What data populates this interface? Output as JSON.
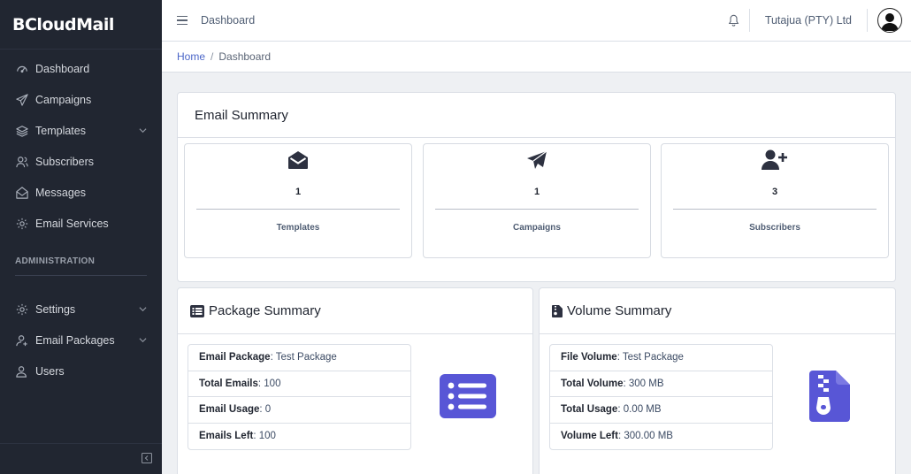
{
  "brand": {
    "name": "BCloudMail"
  },
  "sidebar": {
    "items": [
      {
        "label": "Dashboard",
        "icon": "speedometer-icon"
      },
      {
        "label": "Campaigns",
        "icon": "paper-plane-icon"
      },
      {
        "label": "Templates",
        "icon": "layers-icon"
      },
      {
        "label": "Subscribers",
        "icon": "people-icon"
      },
      {
        "label": "Messages",
        "icon": "envelope-open-icon"
      },
      {
        "label": "Email Services",
        "icon": "gear-icon"
      }
    ],
    "admin_title": "ADMINISTRATION",
    "admin_items": [
      {
        "label": "Settings",
        "icon": "gear-icon"
      },
      {
        "label": "Email Packages",
        "icon": "user-add-icon"
      },
      {
        "label": "Users",
        "icon": "user-icon"
      }
    ]
  },
  "header": {
    "title": "Dashboard",
    "company": "Tutajua (PTY) Ltd"
  },
  "breadcrumb": {
    "home": "Home",
    "separator": "/",
    "current": "Dashboard"
  },
  "email_summary": {
    "title": "Email Summary",
    "stats": [
      {
        "value": "1",
        "label": "Templates",
        "icon": "envelope-open-icon"
      },
      {
        "value": "1",
        "label": "Campaigns",
        "icon": "paper-plane-icon"
      },
      {
        "value": "3",
        "label": "Subscribers",
        "icon": "user-plus-icon"
      }
    ]
  },
  "package_summary": {
    "title": "Package Summary",
    "rows": [
      {
        "key": "Email Package",
        "value": ": Test Package"
      },
      {
        "key": "Total Emails",
        "value": ": 100"
      },
      {
        "key": "Email Usage",
        "value": ": 0"
      },
      {
        "key": "Emails Left",
        "value": ": 100"
      }
    ]
  },
  "volume_summary": {
    "title": "Volume Summary",
    "rows": [
      {
        "key": "File Volume",
        "value": ": Test Package"
      },
      {
        "key": "Total Volume",
        "value": ": 300 MB"
      },
      {
        "key": "Total Usage",
        "value": ": 0.00 MB"
      },
      {
        "key": "Volume Left",
        "value": ": 300.00 MB"
      }
    ]
  },
  "colors": {
    "sidebar_bg": "#212631",
    "accent_purple": "#5856d6",
    "link_blue": "#4b66c8"
  }
}
